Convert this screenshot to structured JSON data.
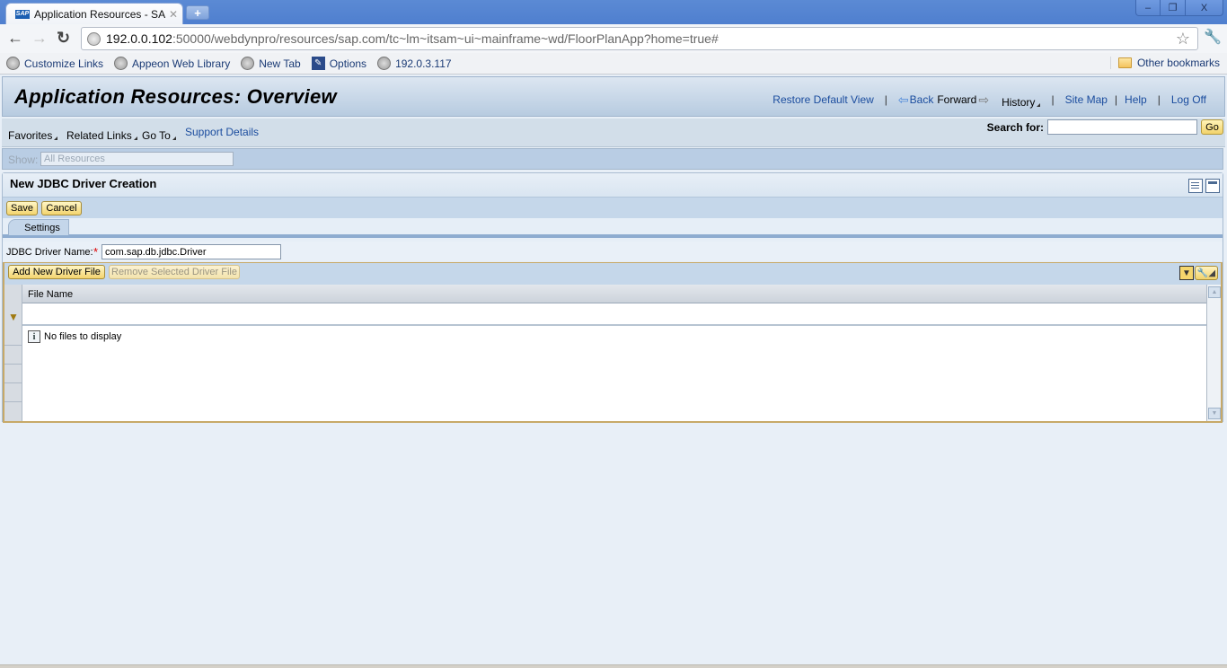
{
  "browser": {
    "tab_title": "Application Resources - SAP N",
    "tab_favicon": "SAP",
    "url_host": "192.0.0.102",
    "url_rest": ":50000/webdynpro/resources/sap.com/tc~lm~itsam~ui~mainframe~wd/FloorPlanApp?home=true#",
    "bookmarks": [
      {
        "label": "Customize Links",
        "icon": "globe-icon"
      },
      {
        "label": "Appeon Web Library",
        "icon": "globe-icon"
      },
      {
        "label": "New Tab",
        "icon": "globe-icon"
      },
      {
        "label": "Options",
        "icon": "wrench-icon"
      },
      {
        "label": "192.0.3.117",
        "icon": "globe-icon"
      }
    ],
    "other_bookmarks": "Other bookmarks",
    "window_controls": {
      "minimize": "–",
      "restore": "❐",
      "close": "X"
    }
  },
  "header": {
    "title": "Application Resources: Overview",
    "restore_default_view": "Restore Default View",
    "back": "Back",
    "forward": "Forward",
    "history": "History",
    "site_map": "Site Map",
    "help": "Help",
    "log_off": "Log Off",
    "separator": "|"
  },
  "menu": {
    "favorites": "Favorites",
    "related_links": "Related Links",
    "go_to": "Go To",
    "support_details": "Support Details",
    "search_label": "Search for:",
    "search_value": "",
    "go_button": "Go"
  },
  "show": {
    "label": "Show:",
    "value": "All Resources"
  },
  "panel": {
    "title": "New JDBC Driver Creation",
    "save": "Save",
    "cancel": "Cancel",
    "tabs": [
      {
        "label": "Settings",
        "active": true
      }
    ],
    "driver_name_label": "JDBC Driver Name:",
    "required_marker": "*",
    "driver_name_value": "com.sap.db.jdbc.Driver",
    "add_file": "Add New Driver File",
    "remove_file": "Remove Selected Driver File"
  },
  "table": {
    "columns": [
      "File Name"
    ],
    "rows": [],
    "empty_message": "No files to display"
  }
}
